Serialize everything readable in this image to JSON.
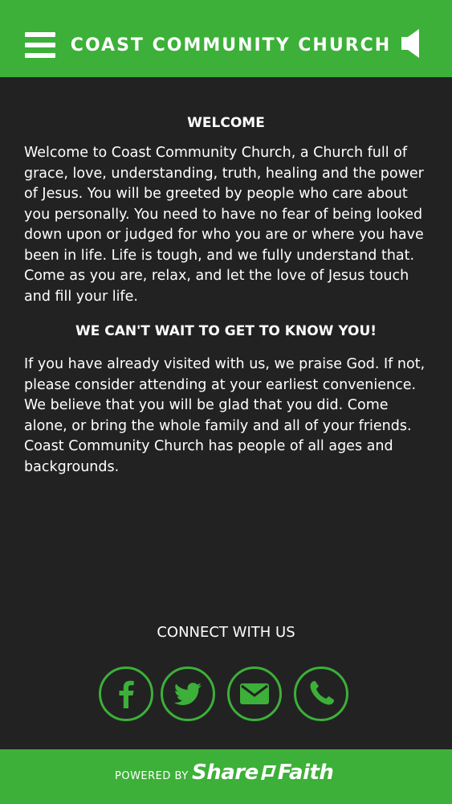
{
  "header": {
    "title": "COAST COMMUNITY CHURCH",
    "menu_icon": "hamburger-menu-icon",
    "audio_icon": "speaker-icon"
  },
  "content": {
    "welcome_heading": "WELCOME",
    "welcome_text": "Welcome to Coast Community Church, a Church full of grace, love, understanding, truth, healing and the power of Jesus. You will be greeted by people who care about you personally. You need to have no fear of being looked down upon or judged for who you are or where you have been in life. Life is tough, and we fully understand that. Come as you are, relax, and let the love of Jesus touch and fill your life.",
    "know_heading": "WE CAN'T WAIT TO GET TO KNOW YOU!",
    "know_text": "If you have already visited with us, we praise God. If not, please consider attending at your earliest convenience. We believe that you will be glad that you did. Come alone, or bring the whole family and all of your friends. Coast Community Church has people of all ages and backgrounds."
  },
  "connect": {
    "label": "CONNECT WITH US",
    "links": [
      {
        "icon": "facebook-icon"
      },
      {
        "icon": "twitter-icon"
      },
      {
        "icon": "email-icon"
      },
      {
        "icon": "phone-icon"
      }
    ]
  },
  "footer": {
    "powered_by": "POWERED BY",
    "brand_left": "Share",
    "brand_right": "Faith"
  },
  "colors": {
    "accent": "#3cb038",
    "background": "#222223",
    "text": "#ffffff"
  }
}
